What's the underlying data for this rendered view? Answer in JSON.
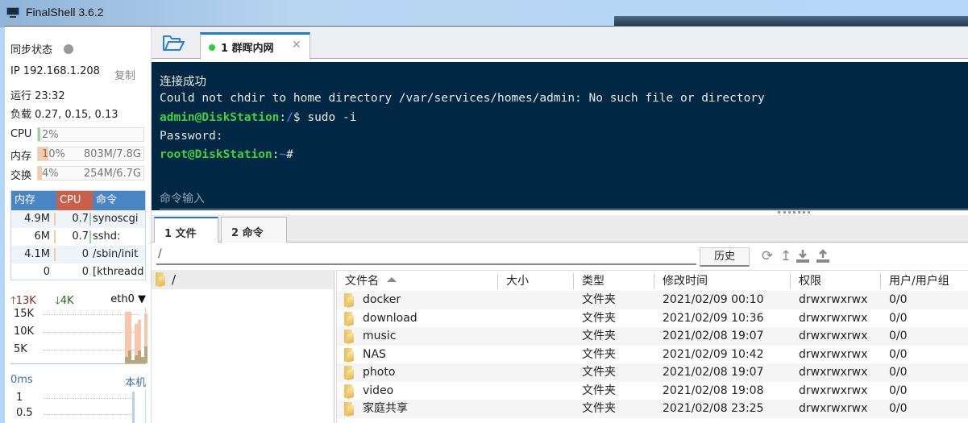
{
  "app": {
    "title": "FinalShell 3.6.2"
  },
  "sidebar": {
    "sync_label": "同步状态",
    "ip": "IP 192.168.1.208",
    "copy_label": "复制",
    "uptime": "运行 23:32",
    "load": "负载 0.27, 0.15, 0.13",
    "meters": [
      {
        "label": "CPU",
        "percent_text": "2%",
        "percent": 2,
        "amount": "",
        "color": "#9bd39b"
      },
      {
        "label": "内存",
        "percent_text": "10%",
        "percent": 10,
        "amount": "803M/7.8G",
        "color": "#f8cba6"
      },
      {
        "label": "交换",
        "percent_text": "4%",
        "percent": 4,
        "amount": "254M/6.7G",
        "color": "#f8cba6"
      }
    ],
    "process_table": {
      "headers": {
        "mem": "内存",
        "cpu": "CPU",
        "cmd": "命令"
      },
      "rows": [
        {
          "mem": "4.9M",
          "cpu": "0.7",
          "cmd": "synoscgi"
        },
        {
          "mem": "6M",
          "cpu": "0.7",
          "cmd": "sshd:"
        },
        {
          "mem": "4.1M",
          "cpu": "0",
          "cmd": "/sbin/init"
        },
        {
          "mem": "0",
          "cpu": "0",
          "cmd": "[kthreadd"
        }
      ]
    },
    "network": {
      "up": "13K",
      "down": "4K",
      "interface": "eth0",
      "ticks": [
        "15K",
        "10K",
        "5K"
      ],
      "upload_series_k": [
        0,
        0,
        0,
        0,
        15.5,
        15.5,
        0,
        12,
        13,
        0,
        15
      ],
      "download_series_k": [
        0,
        0,
        0,
        0,
        2,
        4,
        1,
        2.5,
        4,
        2,
        5
      ]
    },
    "ping": {
      "latency": "0ms",
      "host": "本机",
      "ticks": [
        "1",
        "0.5"
      ]
    }
  },
  "session_tab": {
    "name": "1 群晖内网",
    "status_color": "#2ecc40"
  },
  "terminal": {
    "lines": [
      {
        "text": "连接成功"
      },
      {
        "text": "Could not chdir to home directory /var/services/homes/admin: No such file or directory"
      },
      {
        "user": "admin@DiskStation",
        "sep": ":",
        "path": "/",
        "rest": "$ sudo -i"
      },
      {
        "text": "Password:"
      },
      {
        "user": "root@DiskStation",
        "sep": ":",
        "path": "~",
        "rest": "#"
      }
    ],
    "input_placeholder": "命令输入"
  },
  "bottom_tabs": [
    {
      "label": "1 文件",
      "active": true
    },
    {
      "label": "2 命令",
      "active": false
    }
  ],
  "file_browser": {
    "path": "/",
    "history_label": "历史",
    "toolbar_icons": [
      "refresh-icon",
      "parent-dir-icon",
      "download-icon",
      "upload-icon"
    ],
    "tree": [
      {
        "label": "/"
      }
    ],
    "columns": [
      "文件名",
      "大小",
      "类型",
      "修改时间",
      "权限",
      "用户/用户组"
    ],
    "files": [
      {
        "name": "docker",
        "size": "",
        "type": "文件夹",
        "modified": "2021/02/09 00:10",
        "perm": "drwxrwxrwx",
        "owner": "0/0"
      },
      {
        "name": "download",
        "size": "",
        "type": "文件夹",
        "modified": "2021/02/09 10:36",
        "perm": "drwxrwxrwx",
        "owner": "0/0"
      },
      {
        "name": "music",
        "size": "",
        "type": "文件夹",
        "modified": "2021/02/08 19:07",
        "perm": "drwxrwxrwx",
        "owner": "0/0"
      },
      {
        "name": "NAS",
        "size": "",
        "type": "文件夹",
        "modified": "2021/02/09 10:42",
        "perm": "drwxrwxrwx",
        "owner": "0/0"
      },
      {
        "name": "photo",
        "size": "",
        "type": "文件夹",
        "modified": "2021/02/08 19:07",
        "perm": "drwxrwxrwx",
        "owner": "0/0"
      },
      {
        "name": "video",
        "size": "",
        "type": "文件夹",
        "modified": "2021/02/08 19:08",
        "perm": "drwxrwxrwx",
        "owner": "0/0"
      },
      {
        "name": "家庭共享",
        "size": "",
        "type": "文件夹",
        "modified": "2021/02/08 23:25",
        "perm": "drwxrwxrwx",
        "owner": "0/0"
      }
    ]
  }
}
